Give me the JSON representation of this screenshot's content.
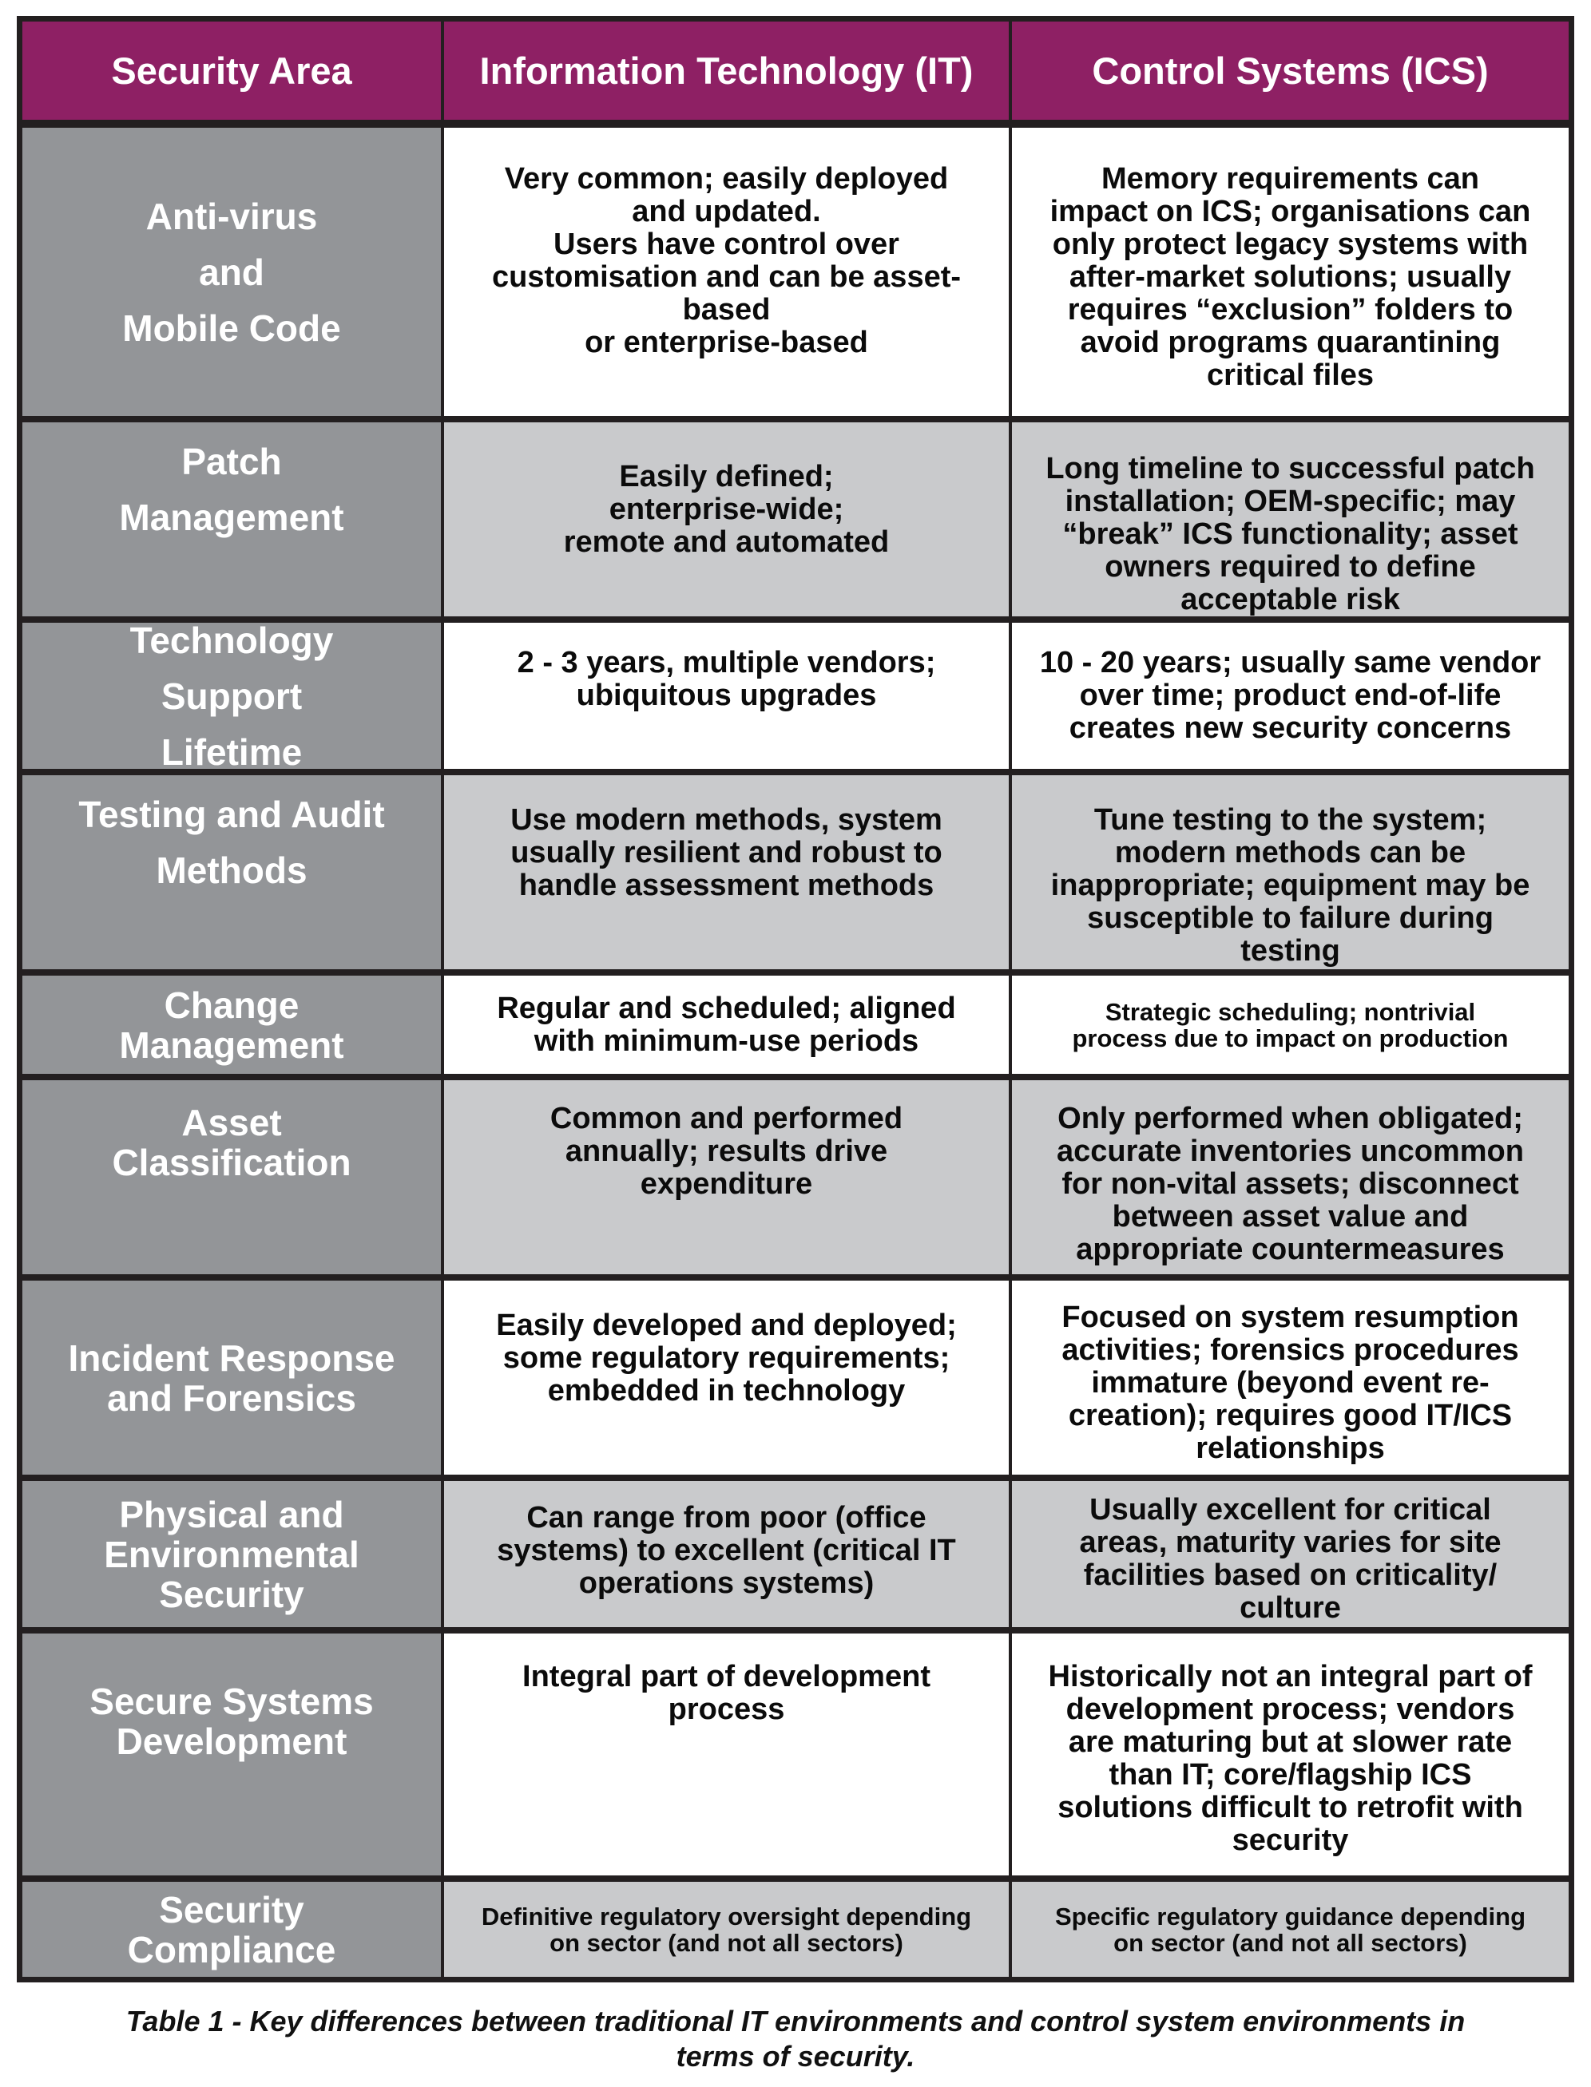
{
  "colors": {
    "header_bg": "#8e2064",
    "area_bg": "#939598",
    "row_alt_bg": "#c9cacc",
    "row_bg": "#ffffff",
    "border": "#231f20"
  },
  "table": {
    "headers": [
      "Security Area",
      "Information Technology (IT)",
      "Control Systems (ICS)"
    ],
    "rows": [
      {
        "area": [
          "Anti-virus",
          "and",
          "Mobile Code"
        ],
        "it": [
          "Very common; easily deployed",
          "and updated.",
          "Users have control over",
          "customisation and can be asset-",
          "based",
          "or enterprise-based"
        ],
        "ics": [
          "Memory requirements can",
          "impact on ICS; organisations can",
          "only protect legacy systems with",
          "after-market solutions; usually",
          "requires “exclusion” folders to",
          "avoid programs quarantining",
          "critical files"
        ]
      },
      {
        "area": [
          "Patch",
          "Management"
        ],
        "it": [
          "Easily defined;",
          "enterprise-wide;",
          "remote and automated"
        ],
        "ics": [
          "Long timeline to successful patch",
          "installation; OEM-specific; may",
          "“break” ICS functionality; asset",
          "owners required to define",
          "acceptable risk"
        ]
      },
      {
        "area": [
          "Technology",
          "Support",
          "Lifetime"
        ],
        "it": [
          "2 - 3 years, multiple vendors;",
          "ubiquitous upgrades"
        ],
        "ics": [
          "10 - 20 years; usually same vendor",
          "over time; product end-of-life",
          "creates new security concerns"
        ]
      },
      {
        "area": [
          "Testing and Audit",
          "Methods"
        ],
        "it": [
          "Use modern methods, system",
          "usually resilient and robust to",
          "handle assessment methods"
        ],
        "ics": [
          "Tune testing to the system;",
          "modern methods can be",
          "inappropriate; equipment may be",
          "susceptible to failure during",
          "testing"
        ]
      },
      {
        "area": [
          "Change",
          "Management"
        ],
        "it": [
          "Regular and scheduled; aligned",
          "with minimum-use periods"
        ],
        "ics": [
          "Strategic scheduling; nontrivial",
          "process due to impact on production"
        ]
      },
      {
        "area": [
          "Asset",
          "Classification"
        ],
        "it": [
          "Common and performed",
          "annually; results drive",
          "expenditure"
        ],
        "ics": [
          "Only performed when obligated;",
          "accurate inventories uncommon",
          "for non-vital assets; disconnect",
          "between asset value and",
          "appropriate countermeasures"
        ]
      },
      {
        "area": [
          "Incident Response",
          "and Forensics"
        ],
        "it": [
          "Easily developed and deployed;",
          "some regulatory requirements;",
          "embedded in technology"
        ],
        "ics": [
          "Focused on system resumption",
          "activities; forensics procedures",
          "immature (beyond event re-",
          "creation); requires good IT/ICS",
          "relationships"
        ]
      },
      {
        "area": [
          "Physical and",
          "Environmental",
          "Security"
        ],
        "it": [
          "Can range from poor (office",
          "systems) to excellent (critical IT",
          "operations systems)"
        ],
        "ics": [
          "Usually excellent for critical",
          "areas, maturity varies for site",
          "facilities based on criticality/",
          "culture"
        ]
      },
      {
        "area": [
          "Secure Systems",
          "Development"
        ],
        "it": [
          "Integral part of development",
          "process"
        ],
        "ics": [
          "Historically not an integral part of",
          "development process; vendors",
          "are maturing but at slower rate",
          "than IT; core/flagship ICS",
          "solutions difficult to retrofit with",
          "security"
        ]
      },
      {
        "area": [
          "Security",
          "Compliance"
        ],
        "it": [
          "Definitive regulatory oversight depending",
          "on sector (and not all sectors)"
        ],
        "ics": [
          "Specific regulatory guidance depending",
          "on sector (and not all sectors)"
        ]
      }
    ]
  },
  "caption": [
    "Table 1 - Key differences between traditional IT environments and control system environments in",
    "terms of security."
  ]
}
